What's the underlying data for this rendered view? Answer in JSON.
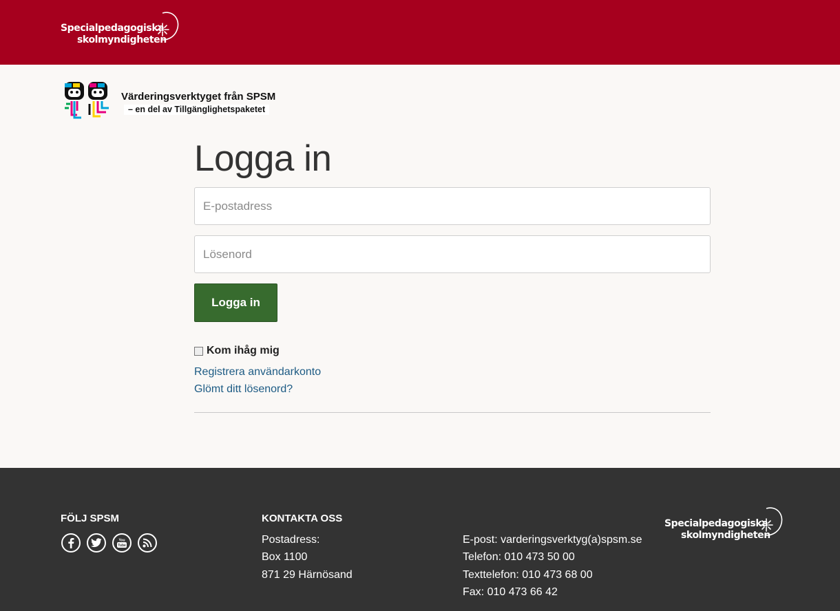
{
  "header": {
    "brand_line1": "Specialpedagogiska",
    "brand_line2": "skolmyndigheten",
    "brand_color": "#a6001e"
  },
  "tool_banner": {
    "title": "Värderingsverktyget från SPSM",
    "subtitle": "– en del av Tillgänglighetspaketet"
  },
  "login": {
    "heading": "Logga in",
    "email_placeholder": "E-postadress",
    "password_placeholder": "Lösenord",
    "submit_label": "Logga in",
    "remember_label": "Kom ihåg mig",
    "remember_checked": false,
    "register_link": "Registrera användarkonto",
    "forgot_link": "Glömt ditt lösenord?",
    "button_color": "#376b2e",
    "link_color": "#1d5b84"
  },
  "footer": {
    "follow_heading": "FÖLJ SPSM",
    "social_icons": [
      "facebook-icon",
      "twitter-icon",
      "youtube-icon",
      "rss-icon"
    ],
    "contact_heading": "KONTAKTA OSS",
    "postal_label": "Postadress:",
    "postal_box": "Box 1100",
    "postal_city": "871 29 Härnösand",
    "email": "E-post: varderingsverktyg(a)spsm.se",
    "phone": "Telefon: 010 473 50 00",
    "textphone": "Texttelefon: 010 473 68 00",
    "fax": "Fax: 010 473 66 42",
    "brand_line1": "Specialpedagogiska",
    "brand_line2": "skolmyndigheten",
    "background_color": "#333333"
  }
}
